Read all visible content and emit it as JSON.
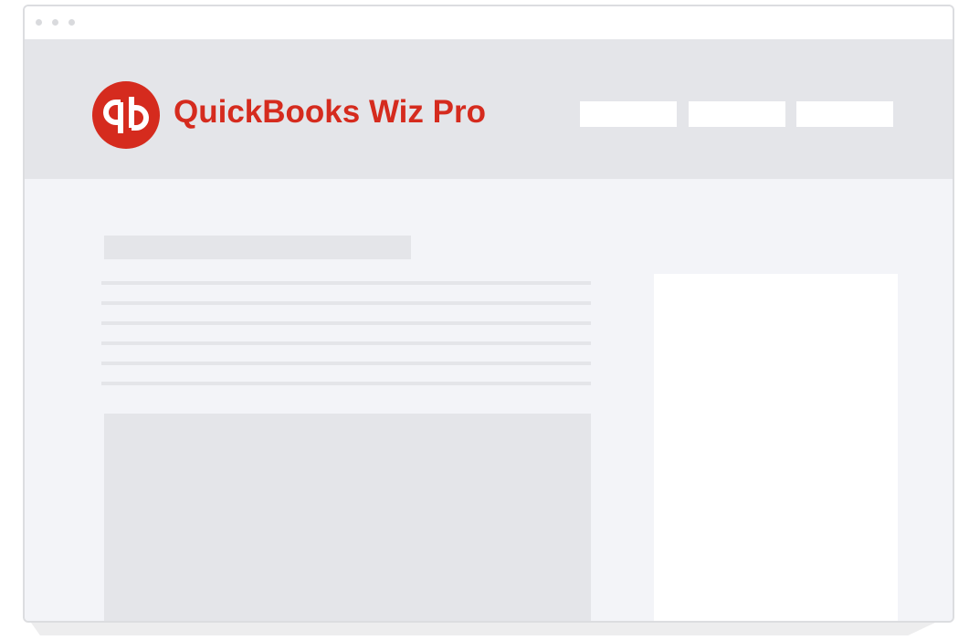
{
  "brand": {
    "name": "QuickBooks Wiz Pro",
    "logo_glyph": "qb",
    "logo_icon": "quickbooks-logo-icon",
    "accent_color": "#d52b1e",
    "logo_glyph_color": "#ffffff"
  },
  "window": {
    "controls": [
      "close",
      "minimize",
      "maximize"
    ],
    "control_color": "#d9dadd"
  },
  "header": {
    "nav_items": [
      "",
      "",
      ""
    ],
    "background_color": "#e4e5e9"
  },
  "content": {
    "background_color": "#f3f4f8",
    "placeholder_color": "#e4e5e9",
    "card_color": "#ffffff"
  }
}
